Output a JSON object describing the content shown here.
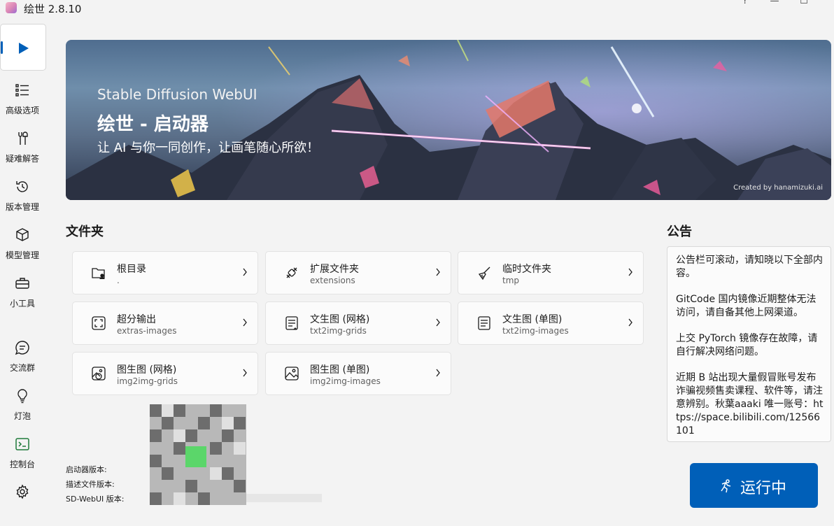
{
  "window": {
    "title": "绘世 2.8.10",
    "help_glyph": "?",
    "minimize_glyph": "—",
    "maximize_glyph": "☐"
  },
  "sidebar": {
    "items": [
      {
        "label": "",
        "icon": "play-icon",
        "active": true
      },
      {
        "label": "高级选项",
        "icon": "list-icon"
      },
      {
        "label": "疑难解答",
        "icon": "tools-icon"
      },
      {
        "label": "版本管理",
        "icon": "history-icon"
      },
      {
        "label": "模型管理",
        "icon": "cube-icon"
      },
      {
        "label": "小工具",
        "icon": "toolbox-icon"
      },
      {
        "label": "交流群",
        "icon": "chat-icon"
      },
      {
        "label": "灯泡",
        "icon": "lightbulb-icon"
      },
      {
        "label": "控制台",
        "icon": "console-icon"
      },
      {
        "label": "",
        "icon": "gear-icon"
      }
    ],
    "accent": "#005fb8"
  },
  "banner": {
    "subtitle": "Stable Diffusion WebUI",
    "title": "绘世 - 启动器",
    "slogan": "让 AI 与你一同创作，让画笔随心所欲！",
    "credit": "Created by hanamizuki.ai"
  },
  "folders": {
    "heading": "文件夹",
    "items": [
      {
        "name": "根目录",
        "path": ".",
        "icon": "folder-user-icon"
      },
      {
        "name": "扩展文件夹",
        "path": "extensions",
        "icon": "plug-icon"
      },
      {
        "name": "临时文件夹",
        "path": "tmp",
        "icon": "broom-icon"
      },
      {
        "name": "超分输出",
        "path": "extras-images",
        "icon": "upscale-icon"
      },
      {
        "name": "文生图 (网格)",
        "path": "txt2img-grids",
        "icon": "doc-grid-icon"
      },
      {
        "name": "文生图 (单图)",
        "path": "txt2img-images",
        "icon": "doc-text-icon"
      },
      {
        "name": "图生图 (网格)",
        "path": "img2img-grids",
        "icon": "image-grid-icon"
      },
      {
        "name": "图生图 (单图)",
        "path": "img2img-images",
        "icon": "image-icon"
      }
    ]
  },
  "notice": {
    "heading": "公告",
    "paragraphs": [
      "公告栏可滚动，请知晓以下全部内容。",
      "GitCode 国内镜像近期整体无法访问，请自备其他上网渠道。",
      "上交 PyTorch 镜像存在故障，请自行解决网络问题。",
      "近期 B 站出现大量假冒账号发布诈骗视频售卖课程、软件等，请注意辨别。秋葉aaaki 唯一账号：https://space.bilibili.com/12566101"
    ]
  },
  "versions": {
    "launcher_label": "启动器版本:",
    "description_label": "描述文件版本:",
    "webui_label": "SD-WebUI 版本:"
  },
  "run_button": {
    "label": "运行中",
    "icon": "running-icon",
    "color": "#005fb8"
  }
}
